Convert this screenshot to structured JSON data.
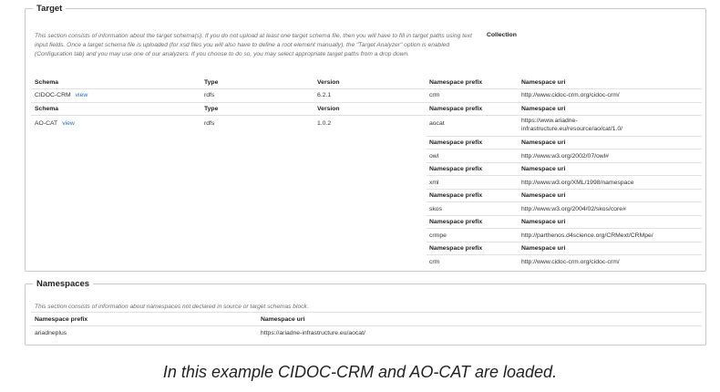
{
  "target": {
    "legend": "Target",
    "description": "This section consists of information about the target schema(s). If you do not upload at least one target schema file, then you will have to fill in target paths using text input fields. Once a target schema file is uploaded (for xsd files you will also have to define a root element manually), the \"Target Analyzer\" option is enabled (Configuration tab) and you may use one of our analyzers. If you choose to do so, you may select appropriate target paths from a drop down.",
    "collection_label": "Collection",
    "headers": {
      "schema": "Schema",
      "type": "Type",
      "version": "Version",
      "ns_prefix": "Namespace prefix",
      "ns_uri": "Namespace uri"
    },
    "schemas": [
      {
        "name": "CIDOC-CRM",
        "view": "view",
        "type": "rdfs",
        "version": "6.2.1",
        "namespaces": [
          {
            "prefix": "crm",
            "uri": "http://www.cidoc-crm.org/cidoc-crm/"
          }
        ]
      },
      {
        "name": "AO-CAT",
        "view": "view",
        "type": "rdfs",
        "version": "1.0.2",
        "namespaces": [
          {
            "prefix": "aocat",
            "uri": "https://www.ariadne-infrastructure.eu/resource/ao/cat/1.0/"
          },
          {
            "prefix": "owl",
            "uri": "http://www.w3.org/2002/07/owl#"
          },
          {
            "prefix": "xml",
            "uri": "http://www.w3.org/XML/1998/namespace"
          },
          {
            "prefix": "skos",
            "uri": "http://www.w3.org/2004/02/skos/core#"
          },
          {
            "prefix": "crmpe",
            "uri": "http://parthenos.d4science.org/CRMext/CRMpe/"
          },
          {
            "prefix": "crm",
            "uri": "http://www.cidoc-crm.org/cidoc-crm/"
          }
        ]
      }
    ]
  },
  "namespaces": {
    "legend": "Namespaces",
    "description": "This section consists of information about namespaces not declared in source or target schemas block.",
    "headers": {
      "prefix": "Namespace prefix",
      "uri": "Namespace uri"
    },
    "rows": [
      {
        "prefix": "ariadneplus",
        "uri": "https://ariadne-infrastructure.eu/aocat/"
      }
    ]
  },
  "caption": "In this example CIDOC-CRM and AO-CAT are loaded."
}
